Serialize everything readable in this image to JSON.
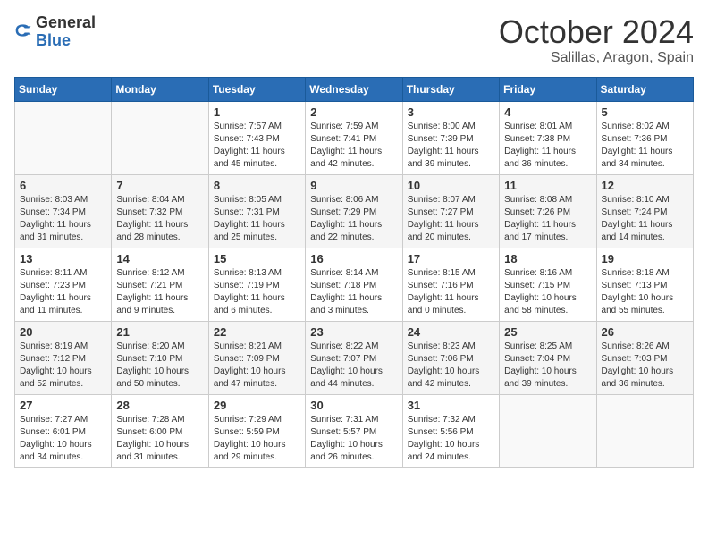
{
  "logo": {
    "general": "General",
    "blue": "Blue"
  },
  "title": "October 2024",
  "location": "Salillas, Aragon, Spain",
  "days_of_week": [
    "Sunday",
    "Monday",
    "Tuesday",
    "Wednesday",
    "Thursday",
    "Friday",
    "Saturday"
  ],
  "weeks": [
    [
      {
        "day": "",
        "sunrise": "",
        "sunset": "",
        "daylight": ""
      },
      {
        "day": "",
        "sunrise": "",
        "sunset": "",
        "daylight": ""
      },
      {
        "day": "1",
        "sunrise": "Sunrise: 7:57 AM",
        "sunset": "Sunset: 7:43 PM",
        "daylight": "Daylight: 11 hours and 45 minutes."
      },
      {
        "day": "2",
        "sunrise": "Sunrise: 7:59 AM",
        "sunset": "Sunset: 7:41 PM",
        "daylight": "Daylight: 11 hours and 42 minutes."
      },
      {
        "day": "3",
        "sunrise": "Sunrise: 8:00 AM",
        "sunset": "Sunset: 7:39 PM",
        "daylight": "Daylight: 11 hours and 39 minutes."
      },
      {
        "day": "4",
        "sunrise": "Sunrise: 8:01 AM",
        "sunset": "Sunset: 7:38 PM",
        "daylight": "Daylight: 11 hours and 36 minutes."
      },
      {
        "day": "5",
        "sunrise": "Sunrise: 8:02 AM",
        "sunset": "Sunset: 7:36 PM",
        "daylight": "Daylight: 11 hours and 34 minutes."
      }
    ],
    [
      {
        "day": "6",
        "sunrise": "Sunrise: 8:03 AM",
        "sunset": "Sunset: 7:34 PM",
        "daylight": "Daylight: 11 hours and 31 minutes."
      },
      {
        "day": "7",
        "sunrise": "Sunrise: 8:04 AM",
        "sunset": "Sunset: 7:32 PM",
        "daylight": "Daylight: 11 hours and 28 minutes."
      },
      {
        "day": "8",
        "sunrise": "Sunrise: 8:05 AM",
        "sunset": "Sunset: 7:31 PM",
        "daylight": "Daylight: 11 hours and 25 minutes."
      },
      {
        "day": "9",
        "sunrise": "Sunrise: 8:06 AM",
        "sunset": "Sunset: 7:29 PM",
        "daylight": "Daylight: 11 hours and 22 minutes."
      },
      {
        "day": "10",
        "sunrise": "Sunrise: 8:07 AM",
        "sunset": "Sunset: 7:27 PM",
        "daylight": "Daylight: 11 hours and 20 minutes."
      },
      {
        "day": "11",
        "sunrise": "Sunrise: 8:08 AM",
        "sunset": "Sunset: 7:26 PM",
        "daylight": "Daylight: 11 hours and 17 minutes."
      },
      {
        "day": "12",
        "sunrise": "Sunrise: 8:10 AM",
        "sunset": "Sunset: 7:24 PM",
        "daylight": "Daylight: 11 hours and 14 minutes."
      }
    ],
    [
      {
        "day": "13",
        "sunrise": "Sunrise: 8:11 AM",
        "sunset": "Sunset: 7:23 PM",
        "daylight": "Daylight: 11 hours and 11 minutes."
      },
      {
        "day": "14",
        "sunrise": "Sunrise: 8:12 AM",
        "sunset": "Sunset: 7:21 PM",
        "daylight": "Daylight: 11 hours and 9 minutes."
      },
      {
        "day": "15",
        "sunrise": "Sunrise: 8:13 AM",
        "sunset": "Sunset: 7:19 PM",
        "daylight": "Daylight: 11 hours and 6 minutes."
      },
      {
        "day": "16",
        "sunrise": "Sunrise: 8:14 AM",
        "sunset": "Sunset: 7:18 PM",
        "daylight": "Daylight: 11 hours and 3 minutes."
      },
      {
        "day": "17",
        "sunrise": "Sunrise: 8:15 AM",
        "sunset": "Sunset: 7:16 PM",
        "daylight": "Daylight: 11 hours and 0 minutes."
      },
      {
        "day": "18",
        "sunrise": "Sunrise: 8:16 AM",
        "sunset": "Sunset: 7:15 PM",
        "daylight": "Daylight: 10 hours and 58 minutes."
      },
      {
        "day": "19",
        "sunrise": "Sunrise: 8:18 AM",
        "sunset": "Sunset: 7:13 PM",
        "daylight": "Daylight: 10 hours and 55 minutes."
      }
    ],
    [
      {
        "day": "20",
        "sunrise": "Sunrise: 8:19 AM",
        "sunset": "Sunset: 7:12 PM",
        "daylight": "Daylight: 10 hours and 52 minutes."
      },
      {
        "day": "21",
        "sunrise": "Sunrise: 8:20 AM",
        "sunset": "Sunset: 7:10 PM",
        "daylight": "Daylight: 10 hours and 50 minutes."
      },
      {
        "day": "22",
        "sunrise": "Sunrise: 8:21 AM",
        "sunset": "Sunset: 7:09 PM",
        "daylight": "Daylight: 10 hours and 47 minutes."
      },
      {
        "day": "23",
        "sunrise": "Sunrise: 8:22 AM",
        "sunset": "Sunset: 7:07 PM",
        "daylight": "Daylight: 10 hours and 44 minutes."
      },
      {
        "day": "24",
        "sunrise": "Sunrise: 8:23 AM",
        "sunset": "Sunset: 7:06 PM",
        "daylight": "Daylight: 10 hours and 42 minutes."
      },
      {
        "day": "25",
        "sunrise": "Sunrise: 8:25 AM",
        "sunset": "Sunset: 7:04 PM",
        "daylight": "Daylight: 10 hours and 39 minutes."
      },
      {
        "day": "26",
        "sunrise": "Sunrise: 8:26 AM",
        "sunset": "Sunset: 7:03 PM",
        "daylight": "Daylight: 10 hours and 36 minutes."
      }
    ],
    [
      {
        "day": "27",
        "sunrise": "Sunrise: 7:27 AM",
        "sunset": "Sunset: 6:01 PM",
        "daylight": "Daylight: 10 hours and 34 minutes."
      },
      {
        "day": "28",
        "sunrise": "Sunrise: 7:28 AM",
        "sunset": "Sunset: 6:00 PM",
        "daylight": "Daylight: 10 hours and 31 minutes."
      },
      {
        "day": "29",
        "sunrise": "Sunrise: 7:29 AM",
        "sunset": "Sunset: 5:59 PM",
        "daylight": "Daylight: 10 hours and 29 minutes."
      },
      {
        "day": "30",
        "sunrise": "Sunrise: 7:31 AM",
        "sunset": "Sunset: 5:57 PM",
        "daylight": "Daylight: 10 hours and 26 minutes."
      },
      {
        "day": "31",
        "sunrise": "Sunrise: 7:32 AM",
        "sunset": "Sunset: 5:56 PM",
        "daylight": "Daylight: 10 hours and 24 minutes."
      },
      {
        "day": "",
        "sunrise": "",
        "sunset": "",
        "daylight": ""
      },
      {
        "day": "",
        "sunrise": "",
        "sunset": "",
        "daylight": ""
      }
    ]
  ]
}
